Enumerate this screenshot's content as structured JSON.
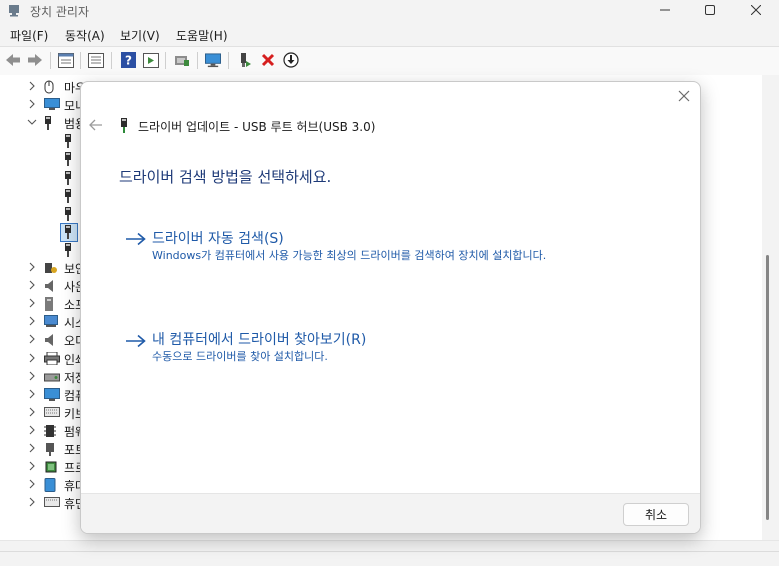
{
  "window": {
    "title": "장치 관리자"
  },
  "menu": [
    "파일(F)",
    "동작(A)",
    "보기(V)",
    "도움말(H)"
  ],
  "toolbar": {
    "icons": [
      "back-icon",
      "forward-icon",
      "properties-icon",
      "list-view-icon",
      "help-icon",
      "run-icon",
      "scan-hardware-icon",
      "monitor-icon",
      "enable-device-icon",
      "uninstall-icon",
      "update-driver-icon"
    ]
  },
  "tree": {
    "items": [
      {
        "label": "마우",
        "icon": "mouse-icon",
        "state": "collapsed"
      },
      {
        "label": "모니",
        "icon": "monitor-icon",
        "state": "collapsed"
      },
      {
        "label": "범용",
        "icon": "usb-icon",
        "state": "expanded"
      },
      {
        "label": "보안",
        "icon": "security-icon",
        "state": "collapsed"
      },
      {
        "label": "사운",
        "icon": "speaker-icon",
        "state": "collapsed"
      },
      {
        "label": "소프",
        "icon": "software-icon",
        "state": "collapsed"
      },
      {
        "label": "시스",
        "icon": "system-icon",
        "state": "collapsed"
      },
      {
        "label": "오디",
        "icon": "audio-icon",
        "state": "collapsed"
      },
      {
        "label": "인쇄",
        "icon": "printer-icon",
        "state": "collapsed"
      },
      {
        "label": "저장",
        "icon": "storage-icon",
        "state": "collapsed"
      },
      {
        "label": "컴퓨",
        "icon": "computer-icon",
        "state": "collapsed"
      },
      {
        "label": "키보",
        "icon": "keyboard-icon",
        "state": "collapsed"
      },
      {
        "label": "펌웨",
        "icon": "firmware-icon",
        "state": "collapsed"
      },
      {
        "label": "포트",
        "icon": "port-icon",
        "state": "collapsed"
      },
      {
        "label": "프로",
        "icon": "processor-icon",
        "state": "collapsed"
      },
      {
        "label": "휴대",
        "icon": "portable-icon",
        "state": "collapsed"
      },
      {
        "label": "휴먼",
        "icon": "hid-icon",
        "state": "collapsed"
      }
    ],
    "usb_children_count": 7,
    "selected_child": 5
  },
  "dialog": {
    "title": "드라이버 업데이트 - USB 루트 허브(USB 3.0)",
    "heading": "드라이버 검색 방법을 선택하세요.",
    "option1": {
      "title": "드라이버 자동 검색(S)",
      "desc": "Windows가 컴퓨터에서 사용 가능한 최상의 드라이버를 검색하여 장치에 설치합니다."
    },
    "option2": {
      "title": "내 컴퓨터에서 드라이버 찾아보기(R)",
      "desc": "수동으로 드라이버를 찾아 설치합니다."
    },
    "cancel_label": "취소"
  },
  "colors": {
    "accent": "#1f5aa8",
    "heading": "#1e3a78",
    "selection": "#cce4f7"
  }
}
